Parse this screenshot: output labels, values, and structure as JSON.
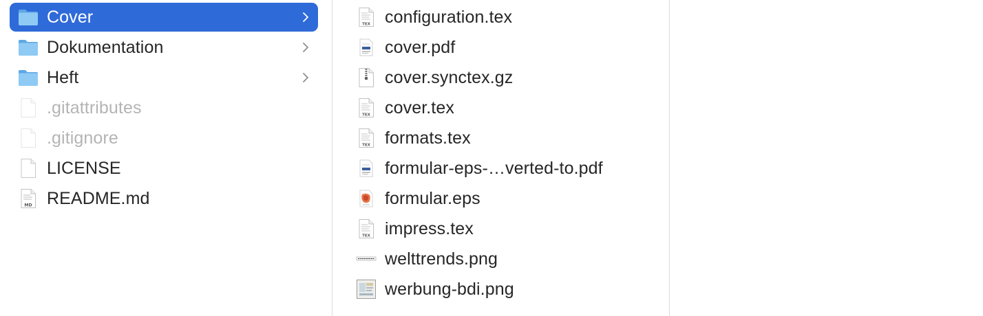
{
  "column1": {
    "items": [
      {
        "label": "Cover",
        "icon": "folder-icon",
        "selected": true
      },
      {
        "label": "Dokumentation",
        "icon": "folder-icon"
      },
      {
        "label": "Heft",
        "icon": "folder-icon"
      },
      {
        "label": ".gitattributes",
        "icon": "document-icon",
        "hidden": true
      },
      {
        "label": ".gitignore",
        "icon": "document-icon",
        "hidden": true
      },
      {
        "label": "LICENSE",
        "icon": "document-icon"
      },
      {
        "label": "README.md",
        "icon": "markdown-file-icon",
        "badge": "MD"
      }
    ]
  },
  "column2": {
    "items": [
      {
        "label": "configuration.tex",
        "icon": "tex-file-icon",
        "badge": "TEX"
      },
      {
        "label": "cover.pdf",
        "icon": "pdf-file-icon"
      },
      {
        "label": "cover.synctex.gz",
        "icon": "zip-archive-icon"
      },
      {
        "label": "cover.tex",
        "icon": "tex-file-icon",
        "badge": "TEX"
      },
      {
        "label": "formats.tex",
        "icon": "tex-file-icon",
        "badge": "TEX"
      },
      {
        "label": "formular-eps-…verted-to.pdf",
        "icon": "pdf-file-icon"
      },
      {
        "label": "formular.eps",
        "icon": "eps-file-icon"
      },
      {
        "label": "impress.tex",
        "icon": "tex-file-icon",
        "badge": "TEX"
      },
      {
        "label": "welttrends.png",
        "icon": "image-thumbnail-icon"
      },
      {
        "label": "werbung-bdi.png",
        "icon": "image-thumbnail-icon"
      }
    ]
  },
  "colors": {
    "selection": "#2f6ad9",
    "folder": "#6bb5ee",
    "text": "#262626",
    "hidden_text": "#b4b4b4"
  }
}
